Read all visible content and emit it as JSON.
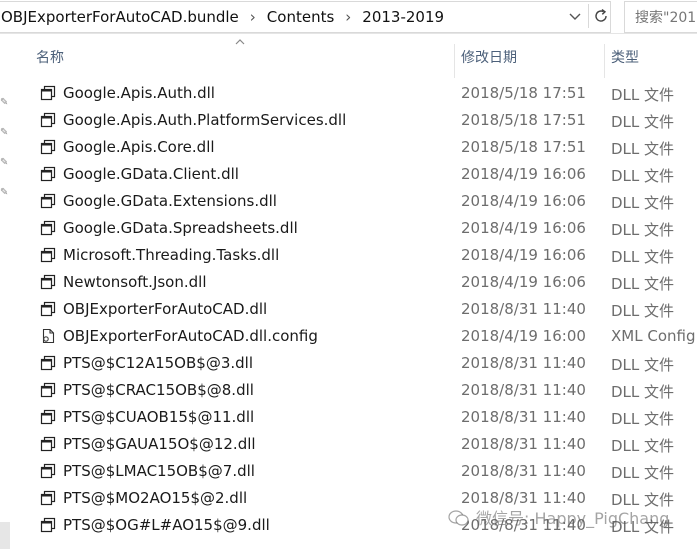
{
  "address": {
    "crumbs": [
      "OBJExporterForAutoCAD.bundle",
      "Contents",
      "2013-2019"
    ],
    "search_placeholder": "搜索\"201"
  },
  "columns": {
    "name": "名称",
    "date": "修改日期",
    "type": "类型"
  },
  "files": [
    {
      "name": "Google.Apis.Auth.dll",
      "date": "2018/5/18 17:51",
      "type": "DLL 文件",
      "icon": "dll-file-icon"
    },
    {
      "name": "Google.Apis.Auth.PlatformServices.dll",
      "date": "2018/5/18 17:51",
      "type": "DLL 文件",
      "icon": "dll-file-icon"
    },
    {
      "name": "Google.Apis.Core.dll",
      "date": "2018/5/18 17:51",
      "type": "DLL 文件",
      "icon": "dll-file-icon"
    },
    {
      "name": "Google.GData.Client.dll",
      "date": "2018/4/19 16:06",
      "type": "DLL 文件",
      "icon": "dll-file-icon"
    },
    {
      "name": "Google.GData.Extensions.dll",
      "date": "2018/4/19 16:06",
      "type": "DLL 文件",
      "icon": "dll-file-icon"
    },
    {
      "name": "Google.GData.Spreadsheets.dll",
      "date": "2018/4/19 16:06",
      "type": "DLL 文件",
      "icon": "dll-file-icon"
    },
    {
      "name": "Microsoft.Threading.Tasks.dll",
      "date": "2018/4/19 16:06",
      "type": "DLL 文件",
      "icon": "dll-file-icon"
    },
    {
      "name": "Newtonsoft.Json.dll",
      "date": "2018/4/19 16:06",
      "type": "DLL 文件",
      "icon": "dll-file-icon"
    },
    {
      "name": "OBJExporterForAutoCAD.dll",
      "date": "2018/8/31 11:40",
      "type": "DLL 文件",
      "icon": "dll-file-icon"
    },
    {
      "name": "OBJExporterForAutoCAD.dll.config",
      "date": "2018/4/19 16:00",
      "type": "XML Config",
      "icon": "config-file-icon"
    },
    {
      "name": "PTS@$C12A15OB$@3.dll",
      "date": "2018/8/31 11:40",
      "type": "DLL 文件",
      "icon": "dll-file-icon"
    },
    {
      "name": "PTS@$CRAC15OB$@8.dll",
      "date": "2018/8/31 11:40",
      "type": "DLL 文件",
      "icon": "dll-file-icon"
    },
    {
      "name": "PTS@$CUAOB15$@11.dll",
      "date": "2018/8/31 11:40",
      "type": "DLL 文件",
      "icon": "dll-file-icon"
    },
    {
      "name": "PTS@$GAUA15O$@12.dll",
      "date": "2018/8/31 11:40",
      "type": "DLL 文件",
      "icon": "dll-file-icon"
    },
    {
      "name": "PTS@$LMAC15OB$@7.dll",
      "date": "2018/8/31 11:40",
      "type": "DLL 文件",
      "icon": "dll-file-icon"
    },
    {
      "name": "PTS@$MO2AO15$@2.dll",
      "date": "2018/8/31 11:40",
      "type": "DLL 文件",
      "icon": "dll-file-icon"
    },
    {
      "name": "PTS@$OG#L#AO15$@9.dll",
      "date": "2018/8/31 11:40",
      "type": "DLL 文件",
      "icon": "dll-file-icon"
    }
  ],
  "watermark": {
    "text": "微信号: Happy_PigChang"
  }
}
